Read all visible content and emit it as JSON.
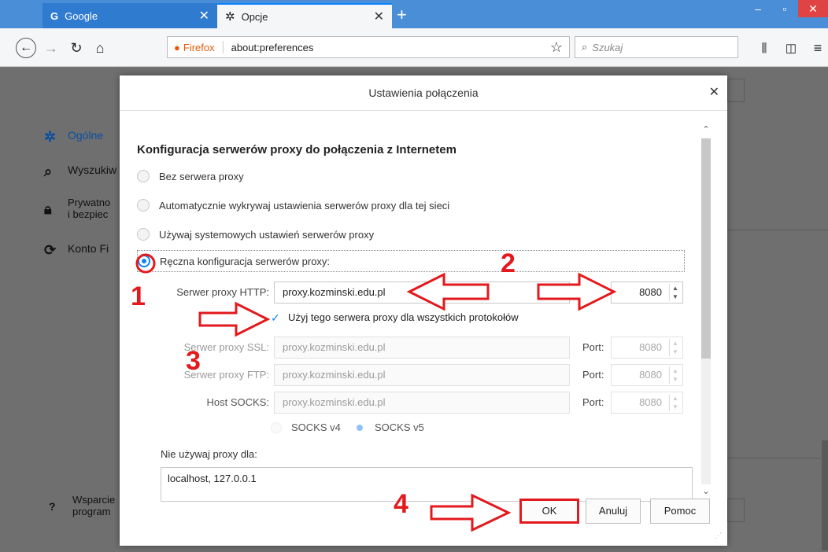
{
  "browser": {
    "tabs": [
      {
        "label": "Google",
        "favicon": "google-g-icon",
        "active": false
      },
      {
        "label": "Opcje",
        "favicon": "gear-icon",
        "active": true
      }
    ],
    "url_brand": "Firefox",
    "url": "about:preferences",
    "search_placeholder": "Szukaj"
  },
  "sidebar": {
    "items": [
      {
        "label": "Ogólne",
        "icon": "gear-icon"
      },
      {
        "label": "Wyszukiw",
        "icon": "search-icon"
      },
      {
        "label": "Prywatno",
        "label2": "i bezpiec",
        "icon": "lock-icon"
      },
      {
        "label": "Konto Fi",
        "icon": "sync-icon"
      }
    ],
    "support": {
      "label": "Wsparcie",
      "label2": "program"
    }
  },
  "dialog": {
    "title": "Ustawienia połączenia",
    "heading": "Konfiguracja serwerów proxy do połączenia z Internetem",
    "options": [
      "Bez serwera proxy",
      "Automatycznie wykrywaj ustawienia serwerów proxy dla tej sieci",
      "Używaj systemowych ustawień serwerów proxy",
      "Ręczna konfiguracja serwerów proxy:"
    ],
    "selected_option": 3,
    "port_label": "Port:",
    "http": {
      "label": "Serwer proxy HTTP:",
      "value": "proxy.kozminski.edu.pl",
      "port": "8080"
    },
    "use_for_all": "Użyj tego serwera proxy dla wszystkich protokołów",
    "ssl": {
      "label": "Serwer proxy SSL:",
      "value": "proxy.kozminski.edu.pl",
      "port": "8080"
    },
    "ftp": {
      "label": "Serwer proxy FTP:",
      "value": "proxy.kozminski.edu.pl",
      "port": "8080"
    },
    "socks": {
      "label": "Host SOCKS:",
      "value": "proxy.kozminski.edu.pl",
      "port": "8080"
    },
    "socks_v4": "SOCKS v4",
    "socks_v5": "SOCKS v5",
    "no_proxy_label": "Nie używaj proxy dla:",
    "no_proxy_value": "localhost, 127.0.0.1",
    "ok": "OK",
    "cancel": "Anuluj",
    "help": "Pomoc"
  },
  "annotations": {
    "n1": "1",
    "n2": "2",
    "n3": "3",
    "n4": "4",
    "color": "#e3191d"
  }
}
